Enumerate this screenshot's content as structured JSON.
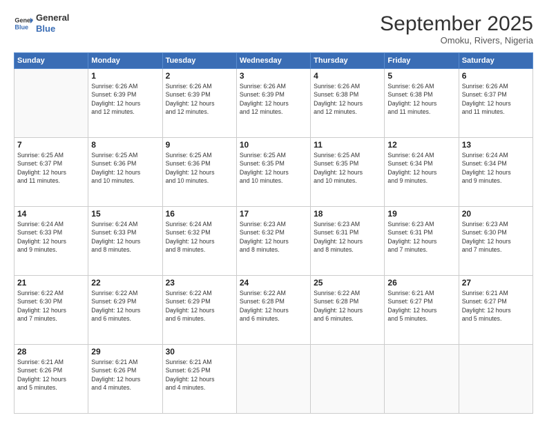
{
  "header": {
    "logo_line1": "General",
    "logo_line2": "Blue",
    "month": "September 2025",
    "location": "Omoku, Rivers, Nigeria"
  },
  "days_of_week": [
    "Sunday",
    "Monday",
    "Tuesday",
    "Wednesday",
    "Thursday",
    "Friday",
    "Saturday"
  ],
  "weeks": [
    [
      {
        "day": "",
        "info": ""
      },
      {
        "day": "1",
        "info": "Sunrise: 6:26 AM\nSunset: 6:39 PM\nDaylight: 12 hours\nand 12 minutes."
      },
      {
        "day": "2",
        "info": "Sunrise: 6:26 AM\nSunset: 6:39 PM\nDaylight: 12 hours\nand 12 minutes."
      },
      {
        "day": "3",
        "info": "Sunrise: 6:26 AM\nSunset: 6:39 PM\nDaylight: 12 hours\nand 12 minutes."
      },
      {
        "day": "4",
        "info": "Sunrise: 6:26 AM\nSunset: 6:38 PM\nDaylight: 12 hours\nand 12 minutes."
      },
      {
        "day": "5",
        "info": "Sunrise: 6:26 AM\nSunset: 6:38 PM\nDaylight: 12 hours\nand 11 minutes."
      },
      {
        "day": "6",
        "info": "Sunrise: 6:26 AM\nSunset: 6:37 PM\nDaylight: 12 hours\nand 11 minutes."
      }
    ],
    [
      {
        "day": "7",
        "info": "Sunrise: 6:25 AM\nSunset: 6:37 PM\nDaylight: 12 hours\nand 11 minutes."
      },
      {
        "day": "8",
        "info": "Sunrise: 6:25 AM\nSunset: 6:36 PM\nDaylight: 12 hours\nand 10 minutes."
      },
      {
        "day": "9",
        "info": "Sunrise: 6:25 AM\nSunset: 6:36 PM\nDaylight: 12 hours\nand 10 minutes."
      },
      {
        "day": "10",
        "info": "Sunrise: 6:25 AM\nSunset: 6:35 PM\nDaylight: 12 hours\nand 10 minutes."
      },
      {
        "day": "11",
        "info": "Sunrise: 6:25 AM\nSunset: 6:35 PM\nDaylight: 12 hours\nand 10 minutes."
      },
      {
        "day": "12",
        "info": "Sunrise: 6:24 AM\nSunset: 6:34 PM\nDaylight: 12 hours\nand 9 minutes."
      },
      {
        "day": "13",
        "info": "Sunrise: 6:24 AM\nSunset: 6:34 PM\nDaylight: 12 hours\nand 9 minutes."
      }
    ],
    [
      {
        "day": "14",
        "info": "Sunrise: 6:24 AM\nSunset: 6:33 PM\nDaylight: 12 hours\nand 9 minutes."
      },
      {
        "day": "15",
        "info": "Sunrise: 6:24 AM\nSunset: 6:33 PM\nDaylight: 12 hours\nand 8 minutes."
      },
      {
        "day": "16",
        "info": "Sunrise: 6:24 AM\nSunset: 6:32 PM\nDaylight: 12 hours\nand 8 minutes."
      },
      {
        "day": "17",
        "info": "Sunrise: 6:23 AM\nSunset: 6:32 PM\nDaylight: 12 hours\nand 8 minutes."
      },
      {
        "day": "18",
        "info": "Sunrise: 6:23 AM\nSunset: 6:31 PM\nDaylight: 12 hours\nand 8 minutes."
      },
      {
        "day": "19",
        "info": "Sunrise: 6:23 AM\nSunset: 6:31 PM\nDaylight: 12 hours\nand 7 minutes."
      },
      {
        "day": "20",
        "info": "Sunrise: 6:23 AM\nSunset: 6:30 PM\nDaylight: 12 hours\nand 7 minutes."
      }
    ],
    [
      {
        "day": "21",
        "info": "Sunrise: 6:22 AM\nSunset: 6:30 PM\nDaylight: 12 hours\nand 7 minutes."
      },
      {
        "day": "22",
        "info": "Sunrise: 6:22 AM\nSunset: 6:29 PM\nDaylight: 12 hours\nand 6 minutes."
      },
      {
        "day": "23",
        "info": "Sunrise: 6:22 AM\nSunset: 6:29 PM\nDaylight: 12 hours\nand 6 minutes."
      },
      {
        "day": "24",
        "info": "Sunrise: 6:22 AM\nSunset: 6:28 PM\nDaylight: 12 hours\nand 6 minutes."
      },
      {
        "day": "25",
        "info": "Sunrise: 6:22 AM\nSunset: 6:28 PM\nDaylight: 12 hours\nand 6 minutes."
      },
      {
        "day": "26",
        "info": "Sunrise: 6:21 AM\nSunset: 6:27 PM\nDaylight: 12 hours\nand 5 minutes."
      },
      {
        "day": "27",
        "info": "Sunrise: 6:21 AM\nSunset: 6:27 PM\nDaylight: 12 hours\nand 5 minutes."
      }
    ],
    [
      {
        "day": "28",
        "info": "Sunrise: 6:21 AM\nSunset: 6:26 PM\nDaylight: 12 hours\nand 5 minutes."
      },
      {
        "day": "29",
        "info": "Sunrise: 6:21 AM\nSunset: 6:26 PM\nDaylight: 12 hours\nand 4 minutes."
      },
      {
        "day": "30",
        "info": "Sunrise: 6:21 AM\nSunset: 6:25 PM\nDaylight: 12 hours\nand 4 minutes."
      },
      {
        "day": "",
        "info": ""
      },
      {
        "day": "",
        "info": ""
      },
      {
        "day": "",
        "info": ""
      },
      {
        "day": "",
        "info": ""
      }
    ]
  ]
}
